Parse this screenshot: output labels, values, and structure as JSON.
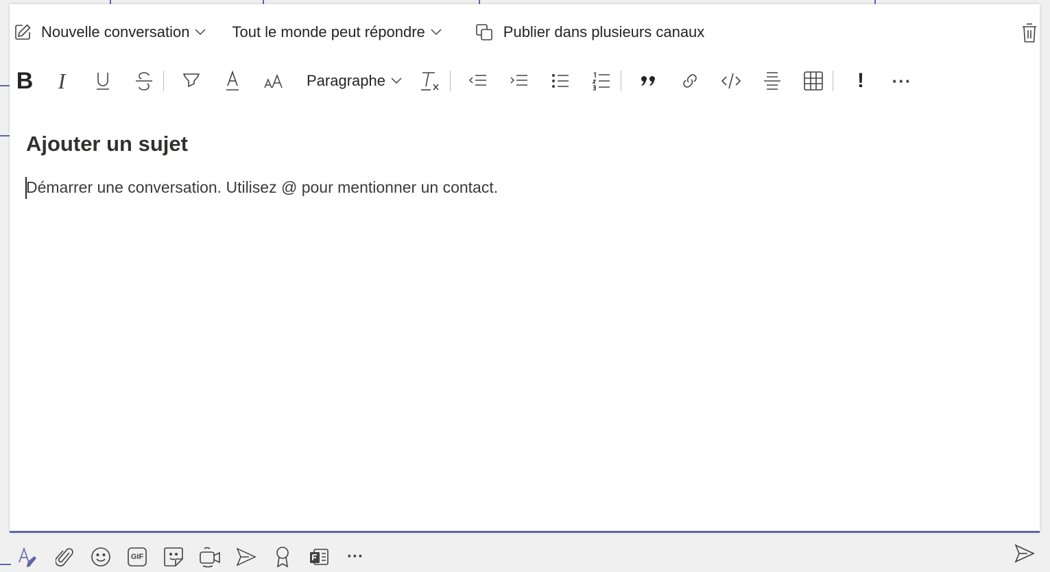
{
  "header": {
    "conversation_type_label": "Nouvelle conversation",
    "reply_permission_label": "Tout le monde peut répondre",
    "post_multiple_label": "Publier dans plusieurs canaux"
  },
  "format_toolbar": {
    "bold": "B",
    "italic": "I",
    "paragraph_label": "Paragraphe",
    "important": "!",
    "more": "···"
  },
  "compose": {
    "subject_placeholder": "Ajouter un sujet",
    "body_placeholder": "Démarrer une conversation. Utilisez @ pour mentionner un contact."
  },
  "bottom_toolbar": {
    "gif_label": "GIF",
    "more": "···"
  },
  "colors": {
    "accent": "#6264a7",
    "text": "#242424",
    "icon": "#424242"
  }
}
